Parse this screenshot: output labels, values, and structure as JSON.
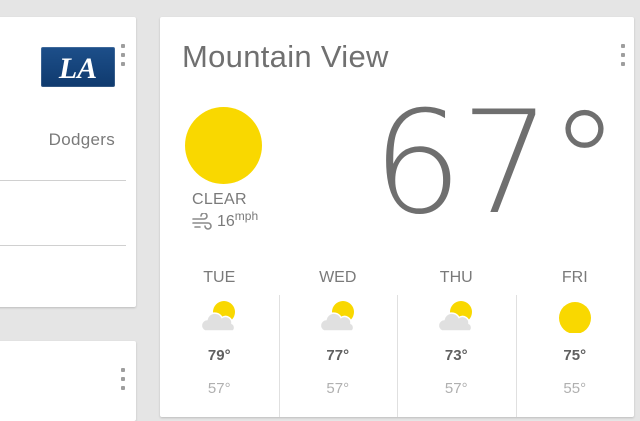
{
  "sports": {
    "team_name": "Dodgers",
    "logo_text": "LA"
  },
  "weather": {
    "city": "Mountain View",
    "current_temp": "67°",
    "condition": "CLEAR",
    "wind_speed": "16",
    "wind_unit": "mph",
    "forecast": [
      {
        "day": "TUE",
        "high": "79°",
        "low": "57°",
        "icon": "partly-cloudy-icon"
      },
      {
        "day": "WED",
        "high": "77°",
        "low": "57°",
        "icon": "partly-cloudy-icon"
      },
      {
        "day": "THU",
        "high": "73°",
        "low": "57°",
        "icon": "partly-cloudy-icon"
      },
      {
        "day": "FRI",
        "high": "75°",
        "low": "55°",
        "icon": "sun-icon"
      }
    ]
  },
  "colors": {
    "background": "#e5e5e5",
    "sun": "#f9d800",
    "cloud": "#e0e0e0",
    "logo_blue": "#1d4f8a"
  }
}
